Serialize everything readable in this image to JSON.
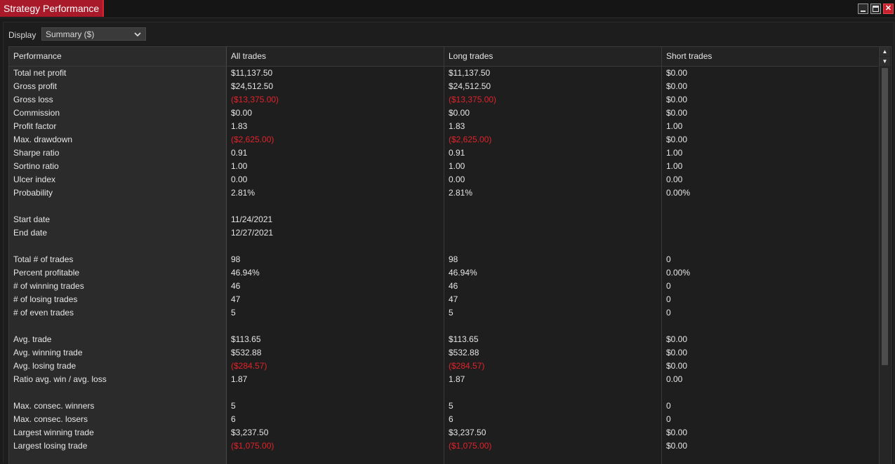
{
  "window": {
    "title": "Strategy Performance",
    "buttons": [
      "minimize",
      "maximize",
      "close"
    ]
  },
  "display": {
    "label": "Display",
    "selected": "Summary ($)"
  },
  "table": {
    "headers": [
      "Performance",
      "All trades",
      "Long trades",
      "Short trades"
    ],
    "rows": [
      {
        "label": "Total net profit",
        "all": "$11,137.50",
        "long": "$11,137.50",
        "short": "$0.00"
      },
      {
        "label": "Gross profit",
        "all": "$24,512.50",
        "long": "$24,512.50",
        "short": "$0.00"
      },
      {
        "label": "Gross loss",
        "all": "($13,375.00)",
        "long": "($13,375.00)",
        "short": "$0.00"
      },
      {
        "label": "Commission",
        "all": "$0.00",
        "long": "$0.00",
        "short": "$0.00"
      },
      {
        "label": "Profit factor",
        "all": "1.83",
        "long": "1.83",
        "short": "1.00"
      },
      {
        "label": "Max. drawdown",
        "all": "($2,625.00)",
        "long": "($2,625.00)",
        "short": "$0.00"
      },
      {
        "label": "Sharpe ratio",
        "all": "0.91",
        "long": "0.91",
        "short": "1.00"
      },
      {
        "label": "Sortino ratio",
        "all": "1.00",
        "long": "1.00",
        "short": "1.00"
      },
      {
        "label": "Ulcer index",
        "all": "0.00",
        "long": "0.00",
        "short": "0.00"
      },
      {
        "label": "Probability",
        "all": "2.81%",
        "long": "2.81%",
        "short": "0.00%"
      },
      {
        "label": "",
        "all": "",
        "long": "",
        "short": ""
      },
      {
        "label": "Start date",
        "all": "11/24/2021",
        "long": "",
        "short": ""
      },
      {
        "label": "End date",
        "all": "12/27/2021",
        "long": "",
        "short": ""
      },
      {
        "label": "",
        "all": "",
        "long": "",
        "short": ""
      },
      {
        "label": "Total # of trades",
        "all": "98",
        "long": "98",
        "short": "0"
      },
      {
        "label": "Percent profitable",
        "all": "46.94%",
        "long": "46.94%",
        "short": "0.00%"
      },
      {
        "label": "# of winning trades",
        "all": "46",
        "long": "46",
        "short": "0"
      },
      {
        "label": "# of losing trades",
        "all": "47",
        "long": "47",
        "short": "0"
      },
      {
        "label": "# of even trades",
        "all": "5",
        "long": "5",
        "short": "0"
      },
      {
        "label": "",
        "all": "",
        "long": "",
        "short": ""
      },
      {
        "label": "Avg. trade",
        "all": "$113.65",
        "long": "$113.65",
        "short": "$0.00"
      },
      {
        "label": "Avg. winning trade",
        "all": "$532.88",
        "long": "$532.88",
        "short": "$0.00"
      },
      {
        "label": "Avg. losing trade",
        "all": "($284.57)",
        "long": "($284.57)",
        "short": "$0.00"
      },
      {
        "label": "Ratio avg. win / avg. loss",
        "all": "1.87",
        "long": "1.87",
        "short": "0.00"
      },
      {
        "label": "",
        "all": "",
        "long": "",
        "short": ""
      },
      {
        "label": "Max. consec. winners",
        "all": "5",
        "long": "5",
        "short": "0"
      },
      {
        "label": "Max. consec. losers",
        "all": "6",
        "long": "6",
        "short": "0"
      },
      {
        "label": "Largest winning trade",
        "all": "$3,237.50",
        "long": "$3,237.50",
        "short": "$0.00"
      },
      {
        "label": "Largest losing trade",
        "all": "($1,075.00)",
        "long": "($1,075.00)",
        "short": "$0.00"
      }
    ]
  },
  "colors": {
    "accent": "#a8192a",
    "negative": "#e0232b",
    "background": "#1b1b1b"
  }
}
